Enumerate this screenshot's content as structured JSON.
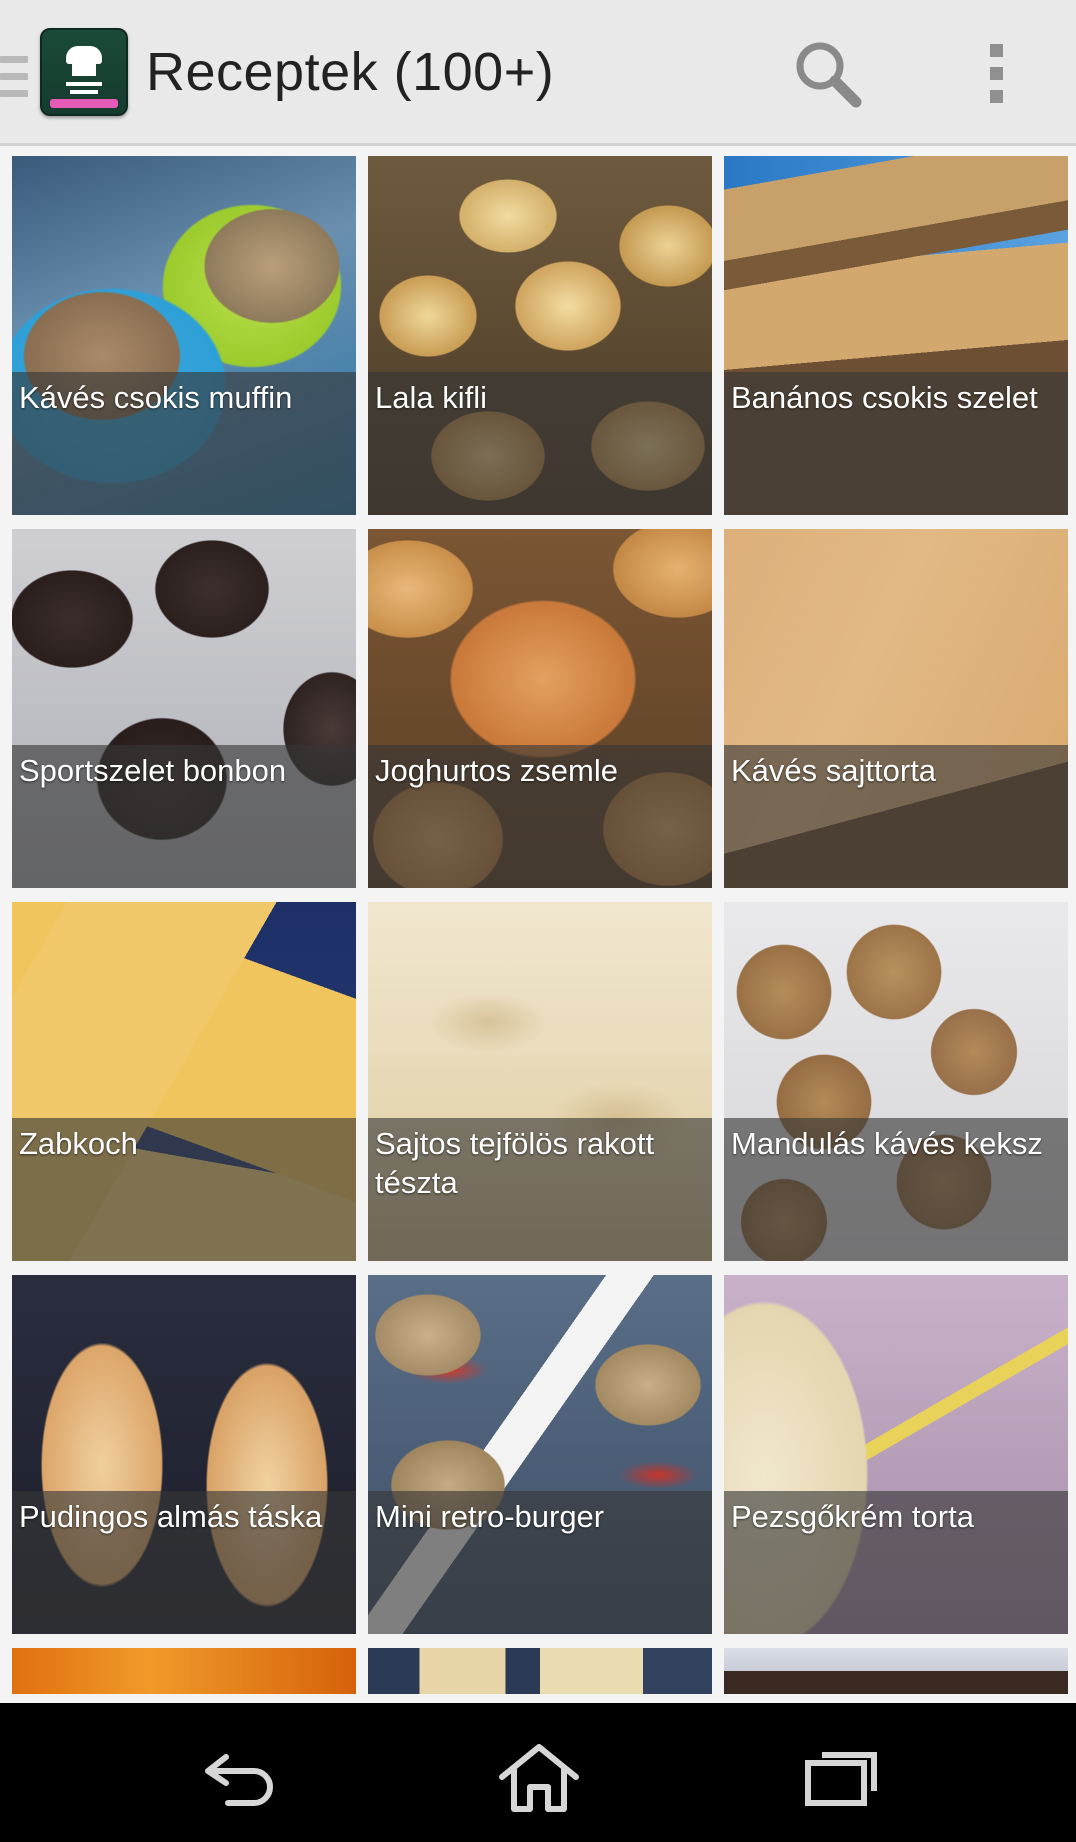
{
  "actionbar": {
    "title": "Receptek (100+)",
    "icons": [
      "drawer-icon",
      "app-icon",
      "search-icon",
      "overflow-menu-icon"
    ]
  },
  "recipes": [
    {
      "title": "Kávés csokis muffin"
    },
    {
      "title": "Lala kifli"
    },
    {
      "title": "Banános csokis szelet"
    },
    {
      "title": "Sportszelet bonbon"
    },
    {
      "title": "Joghurtos zsemle"
    },
    {
      "title": "Kávés sajttorta"
    },
    {
      "title": "Zabkoch"
    },
    {
      "title": "Sajtos tejfölös rakott tészta"
    },
    {
      "title": "Mandulás kávés keksz"
    },
    {
      "title": "Pudingos almás táska"
    },
    {
      "title": "Mini retro-burger"
    },
    {
      "title": "Pezsgőkrém torta"
    }
  ],
  "navbar": {
    "icons": [
      "back-icon",
      "home-icon",
      "recent-apps-icon"
    ]
  }
}
